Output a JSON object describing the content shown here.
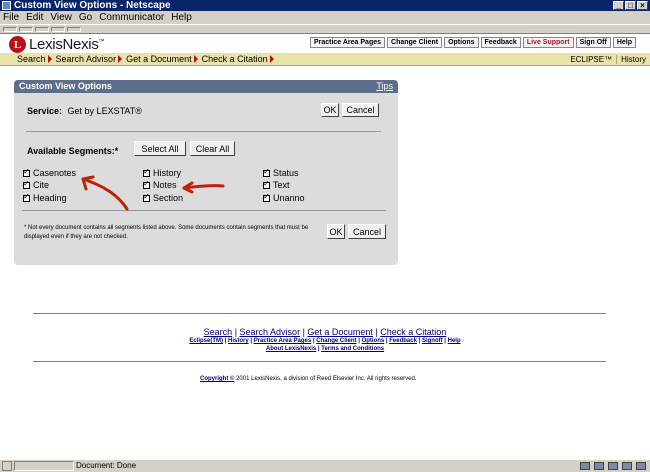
{
  "window": {
    "title": "Custom View Options - Netscape"
  },
  "menubar": {
    "items": [
      "File",
      "Edit",
      "View",
      "Go",
      "Communicator",
      "Help"
    ]
  },
  "header": {
    "logo_letter": "L",
    "logo_text": "LexisNexis",
    "logo_tm": "™",
    "top_links": [
      "Practice Area Pages",
      "Change Client",
      "Options",
      "Feedback",
      "Live Support",
      "Sign Off",
      "Help"
    ]
  },
  "nav": {
    "items": [
      "Search",
      "Search Advisor",
      "Get a Document",
      "Check a Citation"
    ],
    "right": [
      "ECLIPSE™",
      "History"
    ]
  },
  "dialog": {
    "title": "Custom View Options",
    "tips": "Tips",
    "service_label": "Service:",
    "service_value": "Get by LEXSTAT®",
    "ok": "OK",
    "cancel": "Cancel",
    "available_label": "Available Segments:*",
    "select_all": "Select All",
    "clear_all": "Clear All",
    "segments": [
      "Casenotes",
      "Cite",
      "Heading",
      "History",
      "Notes",
      "Section",
      "Status",
      "Text",
      "Unanno"
    ],
    "note": "* Not every document contains all segments listed above. Some documents contain segments that must be displayed even if they are not checked."
  },
  "footer": {
    "primary_links": [
      "Search",
      "Search Advisor",
      "Get a Document",
      "Check a Citation"
    ],
    "secondary_links": [
      "Eclipse(TM)",
      "History",
      "Practice Area Pages",
      "Change Client",
      "Options",
      "Feedback",
      "Signoff",
      "Help"
    ],
    "tertiary_links": [
      "About LexisNexis",
      "Terms and Conditions"
    ],
    "copyright_link": "Copyright ©",
    "copyright_text": "2001 LexisNexis, a division of Reed Elsevier Inc. All rights reserved."
  },
  "statusbar": {
    "text": "Document: Done"
  },
  "colors": {
    "titlebar": "#0a246a",
    "brand_red": "#b5121b",
    "nav_bg": "#e8e3a8",
    "dialog_title": "#5b6e8c",
    "annotation": "#c0200a"
  }
}
